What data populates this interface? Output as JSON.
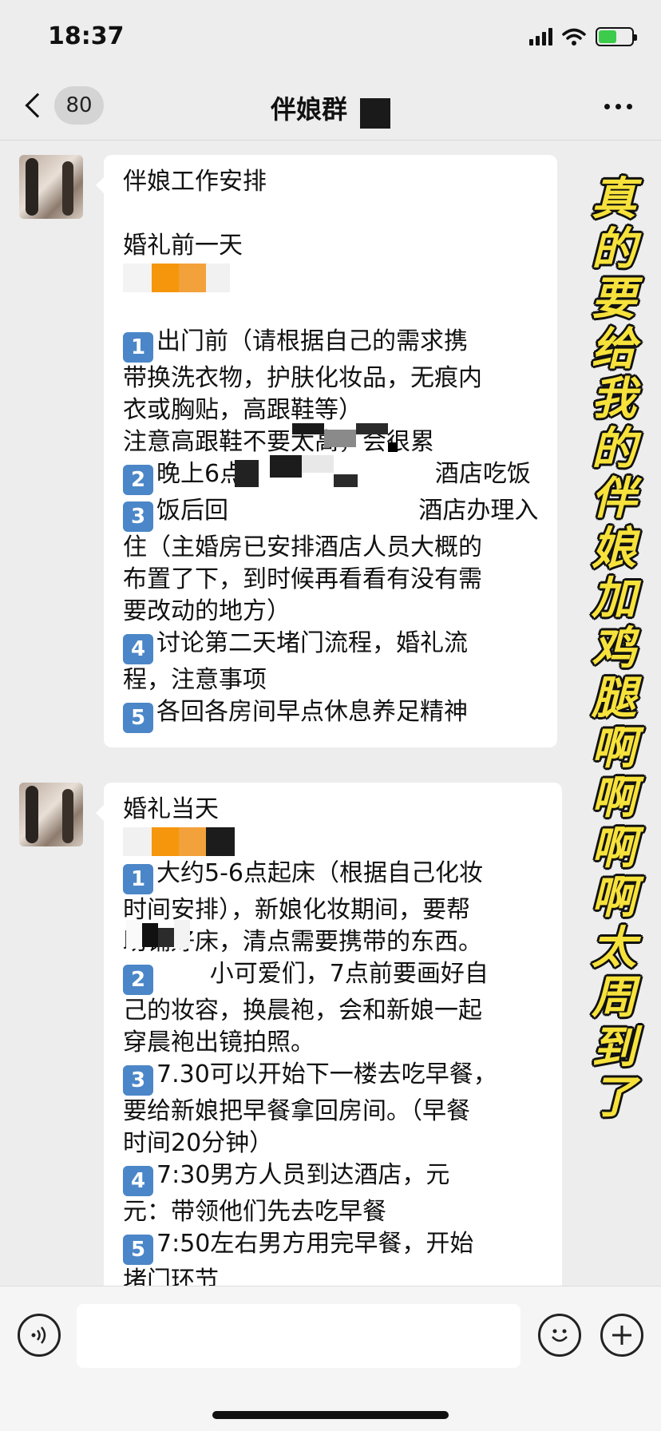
{
  "status_bar": {
    "time": "18:37",
    "battery_color": "#3ccb4a"
  },
  "nav": {
    "unread_count": "80",
    "title": "伴娘群"
  },
  "messages": [
    {
      "lines": [
        {
          "text": "伴娘工作安排"
        },
        {
          "blank": true
        },
        {
          "text": "婚礼前一天"
        },
        {
          "redacted": true
        },
        {
          "blank": true
        },
        {
          "num": "1",
          "text": "出门前（请根据自己的需求携"
        },
        {
          "text": "带换洗衣物，护肤化妆品，无痕内"
        },
        {
          "text": "衣或胸贴，高跟鞋等）"
        },
        {
          "text": "注意高跟鞋不要太高，会很累"
        },
        {
          "num": "2",
          "text": "晚上6点，                      酒店吃饭"
        },
        {
          "num": "3",
          "text": "饭后回                         酒店办理入"
        },
        {
          "text": "住（主婚房已安排酒店人员大概的"
        },
        {
          "text": "布置了下，到时候再看看有没有需"
        },
        {
          "text": "要改动的地方）"
        },
        {
          "num": "4",
          "text": "讨论第二天堵门流程，婚礼流"
        },
        {
          "text": "程，注意事项"
        },
        {
          "num": "5",
          "text": "各回各房间早点休息养足精神"
        }
      ]
    },
    {
      "lines": [
        {
          "text": "婚礼当天"
        },
        {
          "redacted": true
        },
        {
          "num": "1",
          "text": "大约5-6点起床（根据自己化妆"
        },
        {
          "text": "时间安排），新娘化妆期间，要帮"
        },
        {
          "text": "助铺好床，清点需要携带的东西。"
        },
        {
          "num": "2",
          "text": "       小可爱们，7点前要画好自"
        },
        {
          "text": "己的妆容，换晨袍，会和新娘一起"
        },
        {
          "text": "穿晨袍出镜拍照。"
        },
        {
          "num": "3",
          "text": "7.30可以开始下一楼去吃早餐，"
        },
        {
          "text": "要给新娘把早餐拿回房间。（早餐"
        },
        {
          "text": "时间20分钟）"
        },
        {
          "num": "4",
          "text": "7:30男方人员到达酒店，元"
        },
        {
          "text": "元：带领他们先去吃早餐"
        },
        {
          "num": "5",
          "text": "7:50左右男方用完早餐，开始"
        },
        {
          "text": "堵门环节"
        }
      ]
    }
  ],
  "overlay_caption": [
    "真",
    "的",
    "要",
    "给",
    "我",
    "的",
    "伴",
    "娘",
    "加",
    "鸡",
    "腿",
    "啊",
    "啊",
    "啊",
    "啊",
    "太",
    "周",
    "到",
    "了"
  ],
  "overlay_color": "#f6e23a"
}
